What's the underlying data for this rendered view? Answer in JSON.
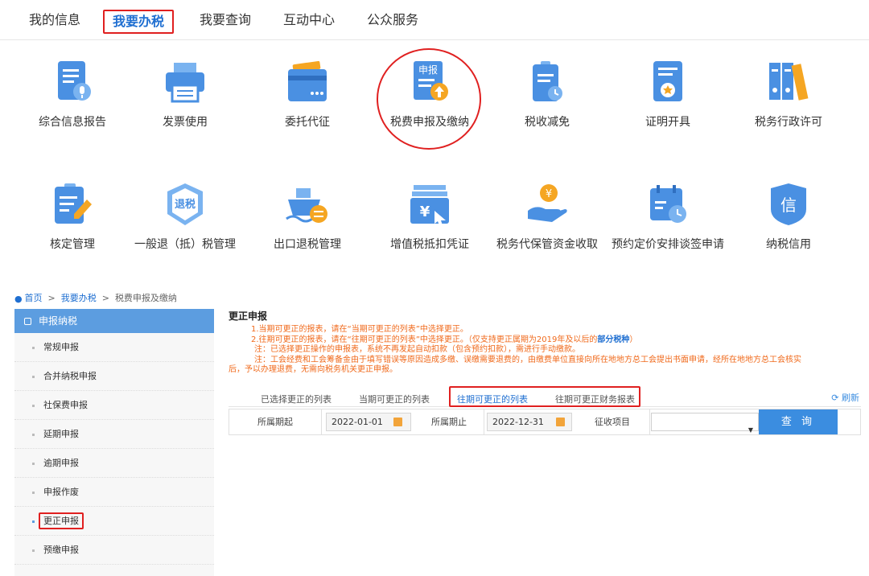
{
  "nav": {
    "tabs": [
      {
        "label": "我的信息"
      },
      {
        "label": "我要办税"
      },
      {
        "label": "我要查询"
      },
      {
        "label": "互动中心"
      },
      {
        "label": "公众服务"
      }
    ]
  },
  "services": [
    {
      "label": "综合信息报告",
      "icon": "report-microphone-icon"
    },
    {
      "label": "发票使用",
      "icon": "printer-icon"
    },
    {
      "label": "委托代征",
      "icon": "card-icon"
    },
    {
      "label": "税费申报及缴纳",
      "icon": "declare-upload-icon",
      "icon_text": "申报"
    },
    {
      "label": "税收减免",
      "icon": "clipboard-clock-icon"
    },
    {
      "label": "证明开具",
      "icon": "certificate-icon"
    },
    {
      "label": "税务行政许可",
      "icon": "binders-icon"
    },
    {
      "label": "核定管理",
      "icon": "clipboard-pencil-icon"
    },
    {
      "label": "一般退（抵）税管理",
      "icon": "refund-badge-icon",
      "icon_text": "退税"
    },
    {
      "label": "出口退税管理",
      "icon": "ship-exchange-icon"
    },
    {
      "label": "增值税抵扣凭证",
      "icon": "voucher-cursor-icon",
      "icon_text": "¥"
    },
    {
      "label": "税务代保管资金收取",
      "icon": "hand-coin-icon",
      "icon_text": "¥"
    },
    {
      "label": "预约定价安排谈签申请",
      "icon": "calendar-clock-icon"
    },
    {
      "label": "纳税信用",
      "icon": "credit-shield-icon",
      "icon_text": "信"
    }
  ],
  "breadcrumb": {
    "home": "首页",
    "sep": ">",
    "level1": "我要办税",
    "level2": "税费申报及缴纳"
  },
  "sidebar": {
    "title": "申报纳税",
    "items": [
      {
        "label": "常规申报"
      },
      {
        "label": "合并纳税申报"
      },
      {
        "label": "社保费申报"
      },
      {
        "label": "延期申报"
      },
      {
        "label": "逾期申报"
      },
      {
        "label": "申报作废"
      },
      {
        "label": "更正申报"
      },
      {
        "label": "预缴申报"
      }
    ]
  },
  "main": {
    "title": "更正申报",
    "notes": {
      "n1": "1.当期可更正的报表，请在“当期可更正的列表”中选择更正。",
      "n2a": "2.往期可更正的报表，请在“往期可更正的列表”中选择更正。（仅支持更正属期为2019年及以后的",
      "n2b": "部分税种",
      "n2c": "）",
      "n3": "注：已选择更正操作的申报表，系统不再发起自动扣款（包含预约扣款），需进行手动缴款。",
      "n4a": "注：工会经费和工会筹备金由于填写错误等原因造成多缴、误缴需要退费的，由缴费单位直接向所在地地方总工会提出书面申请，经所在地地方总工会核实",
      "n4b": "后，予以办理退费，无需向税务机关更正申报。"
    },
    "tabs": [
      {
        "label": "已选择更正的列表"
      },
      {
        "label": "当期可更正的列表"
      },
      {
        "label": "往期可更正的列表"
      },
      {
        "label": "往期可更正财务报表"
      }
    ],
    "refresh_label": "刷新",
    "form": {
      "period_start_label": "所属期起",
      "period_start_value": "2022-01-01",
      "period_end_label": "所属期止",
      "period_end_value": "2022-12-31",
      "item_label": "征收项目",
      "item_value": "",
      "query_button": "查 询"
    }
  },
  "colors": {
    "accent": "#1f6fd1",
    "highlight": "#e02020",
    "notice": "#f06a1c",
    "sidebar_head": "#5c9de0",
    "button": "#3b8de0"
  }
}
